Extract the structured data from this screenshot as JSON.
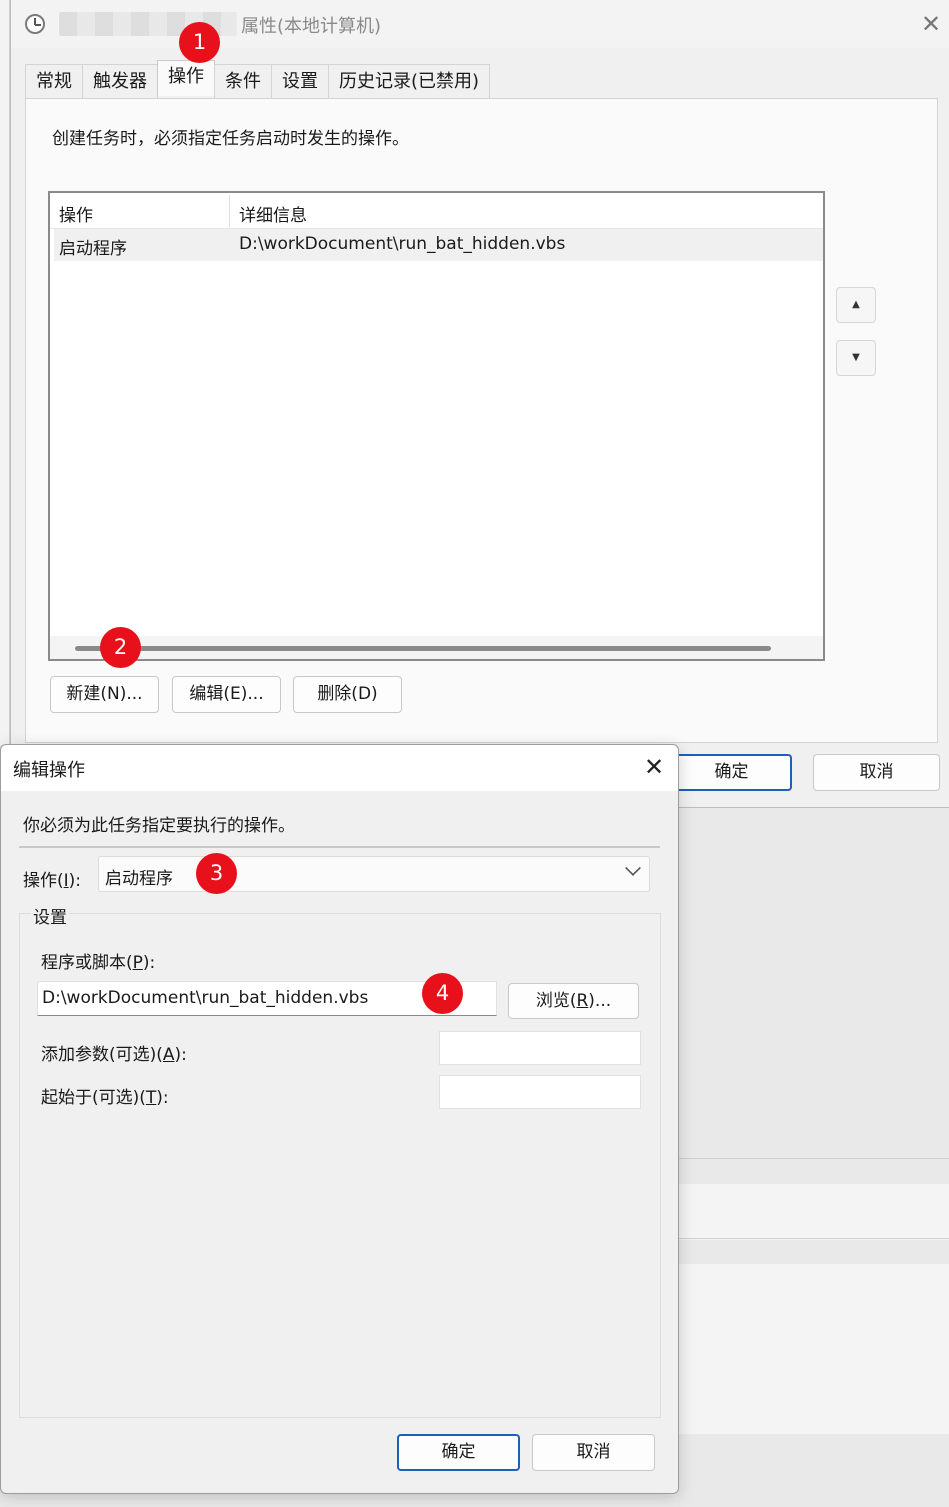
{
  "properties_window": {
    "title": "属性(本地计算机)",
    "close_glyph": "✕",
    "tabs": [
      "常规",
      "触发器",
      "操作",
      "条件",
      "设置",
      "历史记录(已禁用)"
    ],
    "active_tab": "操作",
    "description": "创建任务时，必须指定任务启动时发生的操作。",
    "columns": [
      "操作",
      "详细信息"
    ],
    "rows": [
      {
        "action": "启动程序",
        "details": "D:\\workDocument\\run_bat_hidden.vbs"
      }
    ],
    "move_up_glyph": "▲",
    "move_down_glyph": "▼",
    "new_button": "新建(N)...",
    "edit_button": "编辑(E)...",
    "delete_button": "删除(D)",
    "ok_button": "确定",
    "cancel_button": "取消"
  },
  "edit_dialog": {
    "title": "编辑操作",
    "close_glyph": "✕",
    "description": "你必须为此任务指定要执行的操作。",
    "action_label": "操作(",
    "action_label_key": "I",
    "action_label_end": "):",
    "action_value": "启动程序",
    "group_label": "设置",
    "program_label": "程序或脚本(",
    "program_label_key": "P",
    "program_label_end": "):",
    "program_value": "D:\\workDocument\\run_bat_hidden.vbs",
    "browse_button_start": "浏览(",
    "browse_button_key": "R",
    "browse_button_end": ")...",
    "args_label": "添加参数(可选)(",
    "args_label_key": "A",
    "args_label_end": "):",
    "args_value": "",
    "start_label": "起始于(可选)(",
    "start_label_key": "T",
    "start_label_end": "):",
    "start_value": "",
    "ok_button": "确定",
    "cancel_button": "取消"
  },
  "annotations": [
    "1",
    "2",
    "3",
    "4"
  ],
  "colors": {
    "badge": "#e8101a",
    "primary_border": "#1f5fb8"
  }
}
